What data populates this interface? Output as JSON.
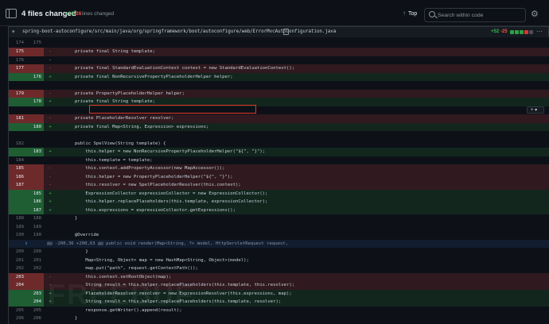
{
  "toolbar": {
    "files_changed": "4 files changed",
    "additions": "+187",
    "deletions": "-26",
    "lines_label": "lines changed",
    "top_label": "Top",
    "search_placeholder": "Search within code"
  },
  "file": {
    "path": "spring-boot-autoconfigure/src/main/java/org/springframework/boot/autoconfigure/web/ErrorMvcAutoConfiguration.java",
    "additions": "+52",
    "deletions": "-25",
    "block_colors": [
      "#2ea043",
      "#2ea043",
      "#2ea043",
      "#da3633",
      "#484f58"
    ]
  },
  "diff_rows": [
    {
      "type": "ctx",
      "old": "174",
      "new": "175",
      "marker": "",
      "code": ""
    },
    {
      "type": "del",
      "old": "175",
      "new": "",
      "marker": "-",
      "code": "        private final String template;"
    },
    {
      "type": "ctx",
      "old": "176",
      "new": "",
      "marker": "-",
      "code": ""
    },
    {
      "type": "del",
      "old": "177",
      "new": "",
      "marker": "-",
      "code": "        private final StandardEvaluationContext context = new StandardEvaluationContext();"
    },
    {
      "type": "add",
      "old": "",
      "new": "176",
      "marker": "+",
      "code": "        private final NonRecursivePropertyPlaceholderHelper helper;"
    },
    {
      "type": "ctx",
      "old": "",
      "new": "",
      "marker": "",
      "code": ""
    },
    {
      "type": "del",
      "old": "179",
      "new": "",
      "marker": "-",
      "code": "        private PropertyPlaceholderHelper helper;"
    },
    {
      "type": "add",
      "old": "",
      "new": "178",
      "marker": "+",
      "code": "        private final String template;"
    },
    {
      "type": "ctx",
      "old": "",
      "new": "",
      "marker": "",
      "code": ""
    },
    {
      "type": "del",
      "old": "181",
      "new": "",
      "marker": "-",
      "code": "        private PlaceholderResolver resolver;"
    },
    {
      "type": "add",
      "old": "",
      "new": "180",
      "marker": "+",
      "code": "        private final Map<String, Expression> expressions;"
    },
    {
      "type": "ctx",
      "old": "",
      "new": "",
      "marker": "",
      "code": ""
    },
    {
      "type": "ctx",
      "old": "182",
      "new": "",
      "marker": "",
      "code": "        public SpelView(String template) {"
    },
    {
      "type": "add",
      "old": "",
      "new": "183",
      "marker": "+",
      "code": "            this.helper = new NonRecursivePropertyPlaceholderHelper(\"${\", \"}\");"
    },
    {
      "type": "ctx",
      "old": "184",
      "new": "",
      "marker": "",
      "code": "            this.template = template;"
    },
    {
      "type": "del",
      "old": "185",
      "new": "",
      "marker": "-",
      "code": "            this.context.addPropertyAccessor(new MapAccessor());"
    },
    {
      "type": "del",
      "old": "186",
      "new": "",
      "marker": "-",
      "code": "            this.helper = new PropertyPlaceholderHelper(\"${\", \"}\");"
    },
    {
      "type": "del",
      "old": "187",
      "new": "",
      "marker": "-",
      "code": "            this.resolver = new SpelPlaceholderResolver(this.context);"
    },
    {
      "type": "add",
      "old": "",
      "new": "185",
      "marker": "+",
      "code": "            ExpressionCollector expressionCollector = new ExpressionCollector();"
    },
    {
      "type": "add",
      "old": "",
      "new": "186",
      "marker": "+",
      "code": "            this.helper.replacePlaceholders(this.template, expressionCollector);"
    },
    {
      "type": "add",
      "old": "",
      "new": "187",
      "marker": "+",
      "code": "            this.expressions = expressionCollector.getExpressions();"
    },
    {
      "type": "ctx",
      "old": "188",
      "new": "188",
      "marker": "",
      "code": "        }"
    },
    {
      "type": "ctx",
      "old": "189",
      "new": "189",
      "marker": "",
      "code": ""
    },
    {
      "type": "ctx",
      "old": "190",
      "new": "190",
      "marker": "",
      "code": "        @Override"
    },
    {
      "type": "hunk",
      "old": "",
      "new": "",
      "marker": "",
      "code": "@@ -200,36 +200,63 @@ public void render(Map<String, ?> model, HttpServletRequest request,"
    },
    {
      "type": "ctx",
      "old": "200",
      "new": "200",
      "marker": "",
      "code": "            }"
    },
    {
      "type": "ctx",
      "old": "201",
      "new": "201",
      "marker": "",
      "code": "            Map<String, Object> map = new HashMap<String, Object>(model);"
    },
    {
      "type": "ctx",
      "old": "202",
      "new": "202",
      "marker": "",
      "code": "            map.put(\"path\", request.getContextPath());"
    },
    {
      "type": "del",
      "old": "203",
      "new": "",
      "marker": "-",
      "code": "            this.context.setRootObject(map);"
    },
    {
      "type": "del",
      "old": "204",
      "new": "",
      "marker": "-",
      "code": "            String result = this.helper.replacePlaceholders(this.template, this.resolver);"
    },
    {
      "type": "add",
      "old": "",
      "new": "203",
      "marker": "+",
      "code": "            PlaceholderResolver resolver = new ExpressionResolver(this.expressions, map);"
    },
    {
      "type": "add",
      "old": "",
      "new": "204",
      "marker": "+",
      "code": "            String result = this.helper.replacePlaceholders(this.template, resolver);"
    },
    {
      "type": "ctx",
      "old": "205",
      "new": "205",
      "marker": "",
      "code": "            response.getWriter().append(result);"
    },
    {
      "type": "ctx",
      "old": "206",
      "new": "206",
      "marker": "",
      "code": "        }"
    }
  ]
}
